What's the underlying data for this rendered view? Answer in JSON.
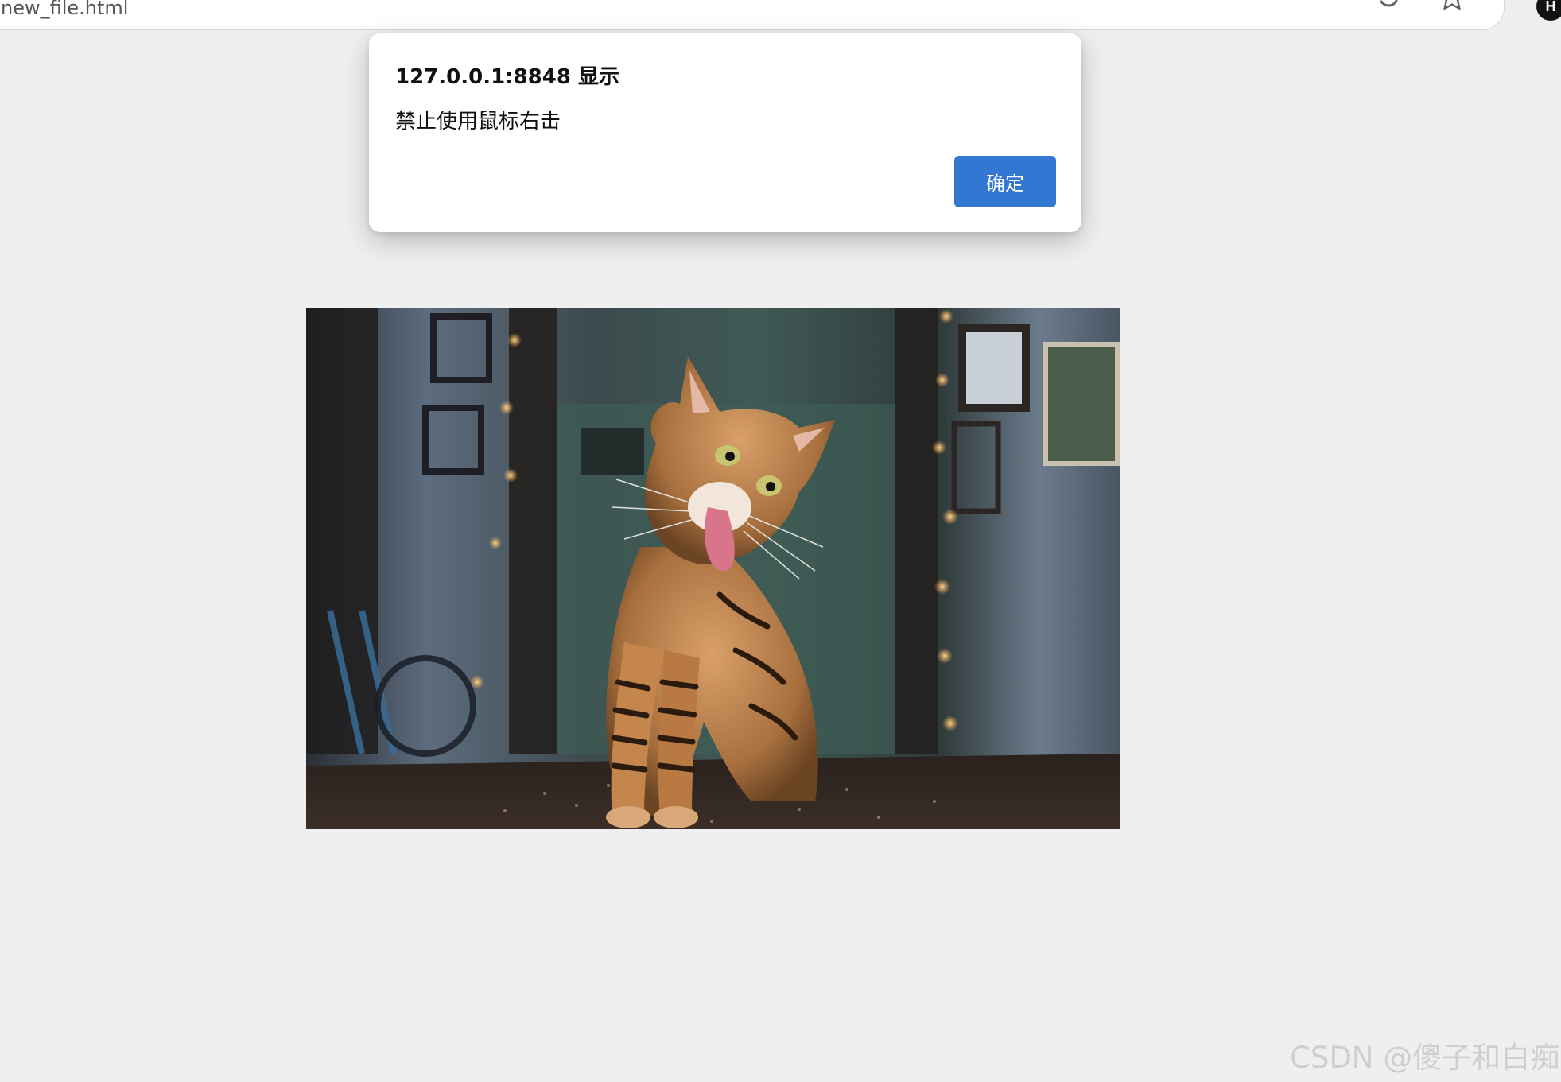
{
  "browser": {
    "address_text": "new_file.html",
    "icons": [
      "refresh-icon",
      "star-icon",
      "profile-icon"
    ],
    "profile_initial": "H"
  },
  "dialog": {
    "origin": "127.0.0.1:8848 显示",
    "message": "禁止使用鼠标右击",
    "ok_label": "确定",
    "button_color": "#3277d1"
  },
  "photo": {
    "subject": "tabby-cat-photo"
  },
  "watermark": "CSDN @傻子和白痴",
  "colors": {
    "page_background": "#efefef",
    "dialog_background": "#ffffff",
    "accent": "#3277d1"
  }
}
